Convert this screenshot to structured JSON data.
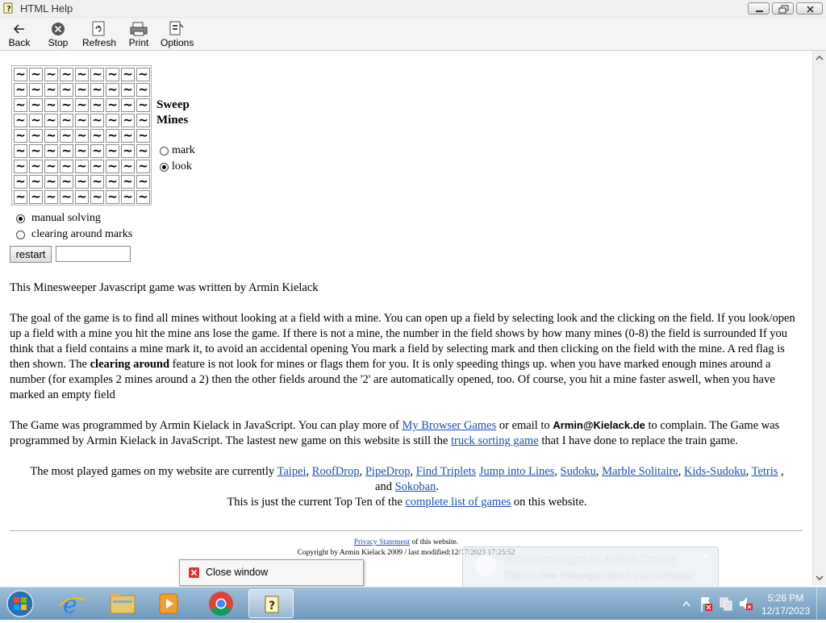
{
  "window": {
    "title": "HTML Help"
  },
  "toolbar": {
    "back": "Back",
    "stop": "Stop",
    "refresh": "Refresh",
    "print": "Print",
    "options": "Options"
  },
  "game": {
    "title_line1": "Sweep",
    "title_line2": "Mines",
    "cell_symbol": "~",
    "rows": 9,
    "cols": 9,
    "mode_mark": "mark",
    "mode_look": "look",
    "selected_mode": "look",
    "solve_manual": "manual solving",
    "solve_clearing": "clearing around marks",
    "selected_solve": "manual solving",
    "restart_label": "restart",
    "counter_value": ""
  },
  "article": {
    "intro": "This Minesweeper Javascript game was written by Armin Kielack",
    "goal_part1": "The goal of the game is to find all mines without looking at a field with a mine. You can open up a field by selecting look and the clicking on the field. If you look/open up a field with a mine you hit the mine ans lose the game. If there is not a mine, the number in the field shows by how many mines (0-8) the field is surrounded If you think that a field contains a mine mark it, to avoid an accidental opening You mark a field by selecting mark and then clicking on the field with the mine. A red flag is then shown. The ",
    "goal_bold": "clearing around",
    "goal_part2": " feature is not look for mines or flags them for you. It is only speeding things up. when you have marked enough mines around a number (for examples 2 mines around a 2) then the other fields around the '2' are automatically opened, too. Of course, you hit a mine faster aswell, when you have marked an empty field",
    "prog_part1": "The Game was programmed by Armin Kielack in JavaScript. You can play more of ",
    "prog_link1": "My Browser Games",
    "prog_part2": " or email to ",
    "prog_email": "Armin@Kielack.de",
    "prog_part3": " to complain. The Game was programmed by Armin Kielack in JavaScript. The lastest new game on this website is still the ",
    "prog_link2": "truck sorting game",
    "prog_part4": " that I have done to replace the train game.",
    "popular_prefix": "The most played games on my website are currently ",
    "popular_games": [
      "Taipei",
      "RoofDrop",
      "PipeDrop",
      "Find Triplets",
      "Jump into Lines",
      "Sudoku",
      "Marble Solitaire",
      "Kids-Sudoku",
      "Tetris"
    ],
    "popular_and": " and ",
    "popular_last": "Sokoban",
    "topten_prefix": "This is just the current Top Ten of the ",
    "topten_link": "complete list of games",
    "topten_suffix": " on this website."
  },
  "footer": {
    "privacy_link": "Privacy Statement",
    "privacy_suffix": " of this website.",
    "copyright": "Copyright by Armin Kielack 2009 / last modified:12/17/2023 17:25:52"
  },
  "popup": {
    "close_window": "Close window"
  },
  "toast": {
    "title": "View messages in Action Center",
    "subtitle": "Click to view messages about your computer"
  },
  "taskbar": {
    "time": "5:26 PM",
    "date": "12/17/2023"
  }
}
